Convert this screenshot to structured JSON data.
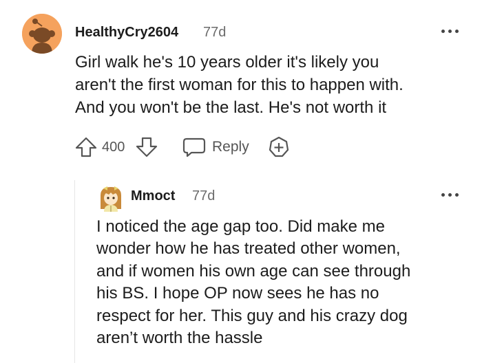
{
  "comment": {
    "username": "HealthyCry2604",
    "time": "77d",
    "lines": [
      "Girl walk he's 10 years older it's likely you",
      "aren't the first woman for this to happen with.",
      "And you won't be the last. He's not worth it"
    ],
    "score": "400",
    "reply_label": "Reply",
    "avatar_color": "#f5a25d"
  },
  "reply": {
    "username": "Mmoct",
    "time": "77d",
    "lines": [
      "I noticed the age gap too. Did make me",
      "wonder how he has treated other women,",
      "and if women his own age can see through",
      "his BS. I hope OP now sees he has no",
      "respect for her. This guy and his crazy dog",
      "aren’t worth the hassle"
    ]
  },
  "icons": [
    "avatar-snoo-icon",
    "more-options-icon",
    "upvote-icon",
    "downvote-icon",
    "reply-bubble-icon",
    "award-plus-icon"
  ]
}
